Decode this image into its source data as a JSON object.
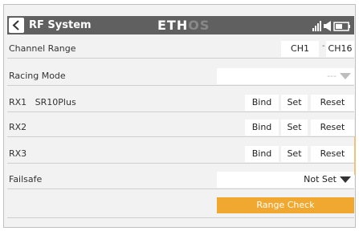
{
  "header": {
    "title": "RF System",
    "logo_part1": "ETH",
    "logo_part2": "OS",
    "icons": [
      "chevron-left-icon",
      "signal-icon",
      "speaker-icon",
      "battery-icon"
    ]
  },
  "rows": {
    "channel_range": {
      "label": "Channel Range",
      "from": "CH1",
      "separator": "-",
      "to": "CH16"
    },
    "racing_mode": {
      "label": "Racing Mode",
      "value": "---"
    },
    "rx1": {
      "label": "RX1   SR10Plus",
      "bind": "Bind",
      "set": "Set",
      "reset": "Reset"
    },
    "rx2": {
      "label": "RX2",
      "bind": "Bind",
      "set": "Set",
      "reset": "Reset"
    },
    "rx3": {
      "label": "RX3",
      "bind": "Bind",
      "set": "Set",
      "reset": "Reset"
    },
    "failsafe": {
      "label": "Failsafe",
      "value": "Not Set"
    }
  },
  "range_check": {
    "label": "Range Check"
  },
  "colors": {
    "header_bg": "#606060",
    "content_bg": "#f2f2f2",
    "accent": "#f0a830",
    "disabled_text": "#bdbdbd"
  }
}
